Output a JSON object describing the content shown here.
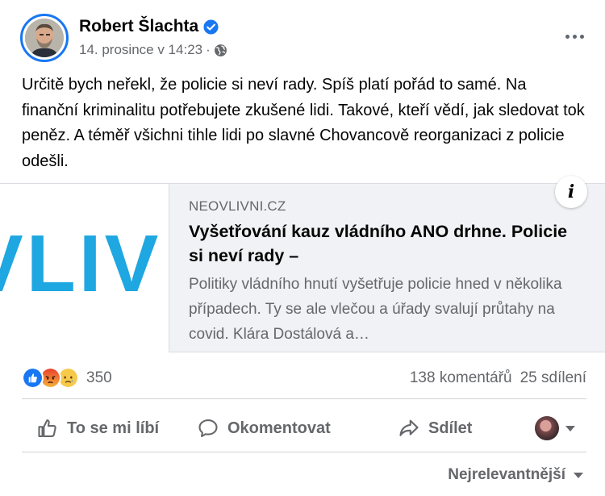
{
  "post": {
    "author": "Robert Šlachta",
    "timestamp": "14. prosince v 14:23",
    "separator": "·",
    "text": "Určitě bych neřekl, že policie si neví rady. Spíš platí pořád to samé. Na finanční kriminalitu potřebujete zkušené lidi. Takové, kteří vědí, jak sledovat tok peněz. A téměř všichni tihle lidi po slavné Chovancově reorganizaci z policie odešli."
  },
  "link": {
    "image_text": "VLIV",
    "domain": "NEOVLIVNI.CZ",
    "title": "Vyšetřování kauz vládního ANO drhne. Policie si neví rady –",
    "description": "Politiky vládního hnutí vyšetřuje policie hned v několika případech. Ty se ale vlečou a úřady svalují průtahy na covid. Klára Dostálová a…",
    "info_icon": "i"
  },
  "stats": {
    "reaction_count": "350",
    "comments": "138 komentářů",
    "shares": "25 sdílení",
    "reaction_icons": [
      "like-icon",
      "angry-icon",
      "sad-icon"
    ]
  },
  "actions": {
    "like": "To se mi líbí",
    "comment": "Okomentovat",
    "share": "Sdílet"
  },
  "comments_sort": {
    "label": "Nejrelevantnější"
  },
  "colors": {
    "accent": "#1877f2",
    "secondary_text": "#65676b",
    "logo_blue": "#1ea7e1"
  }
}
